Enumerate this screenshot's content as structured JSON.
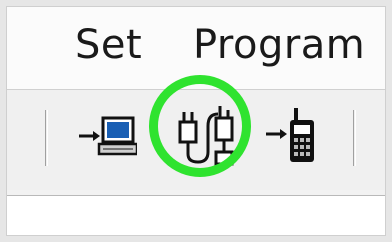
{
  "menubar": {
    "items": [
      {
        "label": "Set"
      },
      {
        "label": "Program"
      }
    ]
  },
  "toolbar": {
    "buttons": [
      {
        "icon": "read-from-radio-icon"
      },
      {
        "icon": "connect-icon",
        "highlighted": true
      },
      {
        "icon": "write-to-radio-icon"
      }
    ]
  },
  "colors": {
    "highlight_ring": "#2fe32f",
    "icon_accent_blue": "#1a5fb4"
  }
}
